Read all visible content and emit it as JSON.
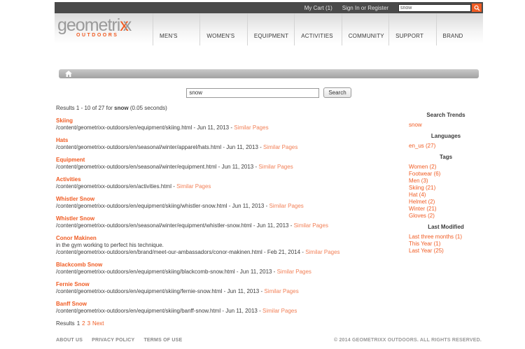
{
  "topbar": {
    "my_cart": "My Cart (1)",
    "sign_in": "Sign In or Register",
    "search_value": "snow"
  },
  "header": {
    "logo": {
      "part1": "geometri",
      "x1": "x",
      "x2": "x",
      "tagline": "OUTDOORS"
    },
    "nav_items": [
      "MEN'S",
      "WOMEN'S",
      "EQUIPMENT",
      "ACTIVITIES",
      "COMMUNITY",
      "SUPPORT",
      "BRAND"
    ]
  },
  "search": {
    "value": "snow",
    "button_label": "Search"
  },
  "results_summary": {
    "prefix": "Results 1 - 10 of 27 for ",
    "term": "snow",
    "suffix": " (0.05 seconds)"
  },
  "strings": {
    "meta_separator": " - ",
    "similar_pages": "Similar Pages"
  },
  "results": [
    {
      "title": "Skiing",
      "path": "/content/geometrixx-outdoors/en/equipment/skiing.html",
      "date": "Jun 11, 2013"
    },
    {
      "title": "Hats",
      "path": "/content/geometrixx-outdoors/en/seasonal/winter/apparel/hats.html",
      "date": "Jun 11, 2013"
    },
    {
      "title": "Equipment",
      "path": "/content/geometrixx-outdoors/en/seasonal/winter/equipment.html",
      "date": "Jun 11, 2013"
    },
    {
      "title": "Activities",
      "path": "/content/geometrixx-outdoors/en/activities.html",
      "date": null
    },
    {
      "title": "Whistler Snow",
      "path": "/content/geometrixx-outdoors/en/equipment/skiing/whistler-snow.html",
      "date": "Jun 11, 2013"
    },
    {
      "title": "Whistler Snow",
      "path": "/content/geometrixx-outdoors/en/seasonal/winter/equipment/whistler-snow.html",
      "date": "Jun 11, 2013"
    },
    {
      "title": "Conor Makinen",
      "snippet": "in the gym working to perfect his technique.",
      "path": "/content/geometrixx-outdoors/en/brand/meet-our-ambassadors/conor-makinen.html",
      "date": "Feb 21, 2014"
    },
    {
      "title": "Blackcomb Snow",
      "path": "/content/geometrixx-outdoors/en/equipment/skiing/blackcomb-snow.html",
      "date": "Jun 11, 2013"
    },
    {
      "title": "Fernie Snow",
      "path": "/content/geometrixx-outdoors/en/equipment/skiing/fernie-snow.html",
      "date": "Jun 11, 2013"
    },
    {
      "title": "Banff Snow",
      "path": "/content/geometrixx-outdoors/en/equipment/skiing/banff-snow.html",
      "date": "Jun 11, 2013"
    }
  ],
  "pagination": {
    "label": "Results",
    "current": "1",
    "pages": [
      "2",
      "3"
    ],
    "next_label": "Next"
  },
  "sidebar": {
    "sections": [
      {
        "heading": "Search Trends",
        "links": [
          "snow"
        ]
      },
      {
        "heading": "Languages",
        "links": [
          "en_us (27)"
        ]
      },
      {
        "heading": "Tags",
        "links": [
          "Women (2)",
          "Footwear (6)",
          "Men (3)",
          "Skiing (21)",
          "Hat (4)",
          "Helmet (2)",
          "Winter (21)",
          "Gloves (2)"
        ]
      },
      {
        "heading": "Last Modified",
        "links": [
          "Last three months (1)",
          "This Year (1)",
          "Last Year (25)"
        ]
      }
    ]
  },
  "footer": {
    "links": [
      "ABOUT US",
      "PRIVACY POLICY",
      "TERMS OF USE"
    ],
    "copyright": "© 2014 GEOMETRIXX OUTDOORS. ALL RIGHTS RESERVED."
  },
  "colors": {
    "accent_orange": "#f05b22",
    "similar_pages_orange": "#f28057",
    "topbar_gray": "#4a4a4a"
  }
}
